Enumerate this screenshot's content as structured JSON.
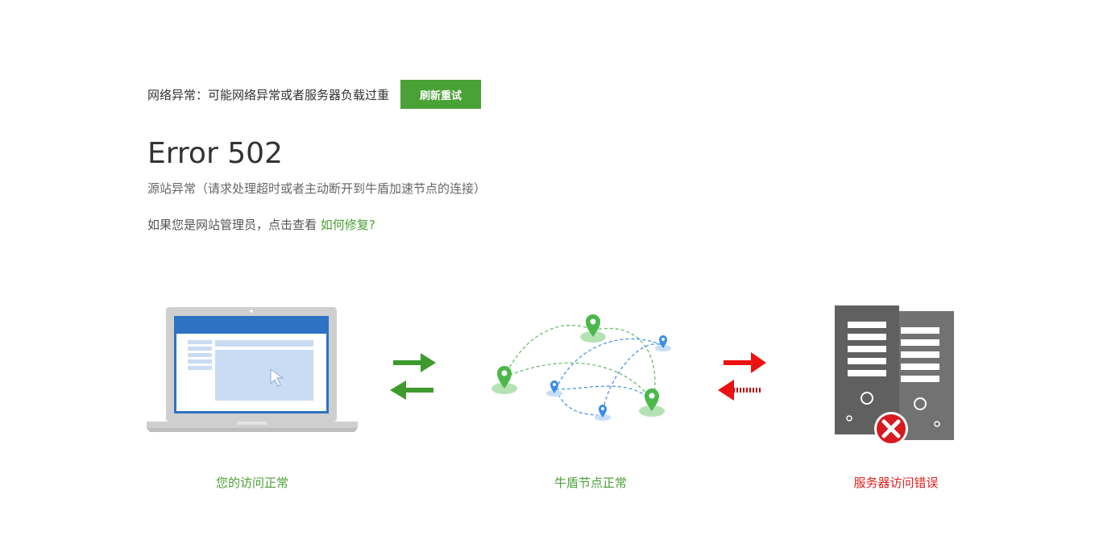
{
  "notice": {
    "text": "网络异常：可能网络异常或者服务器负载过重",
    "retry_label": "刷新重试"
  },
  "error": {
    "title": "Error 502",
    "description": "源站异常（请求处理超时或者主动断开到牛盾加速节点的连接）"
  },
  "admin": {
    "prompt": "如果您是网站管理员，点击查看",
    "link_label": "如何修复?"
  },
  "captions": {
    "visitor": "您的访问正常",
    "node": "牛盾节点正常",
    "server": "服务器访问错误"
  },
  "colors": {
    "brand_green": "#4aa135",
    "error_red": "#e02020",
    "laptop_blue": "#2e72c4"
  },
  "icons": {
    "laptop": "laptop-icon",
    "green_arrows": "bidirectional-arrows-icon",
    "network": "network-nodes-icon",
    "red_arrows": "broken-arrows-icon",
    "servers": "server-icon",
    "error": "error-x-icon"
  }
}
